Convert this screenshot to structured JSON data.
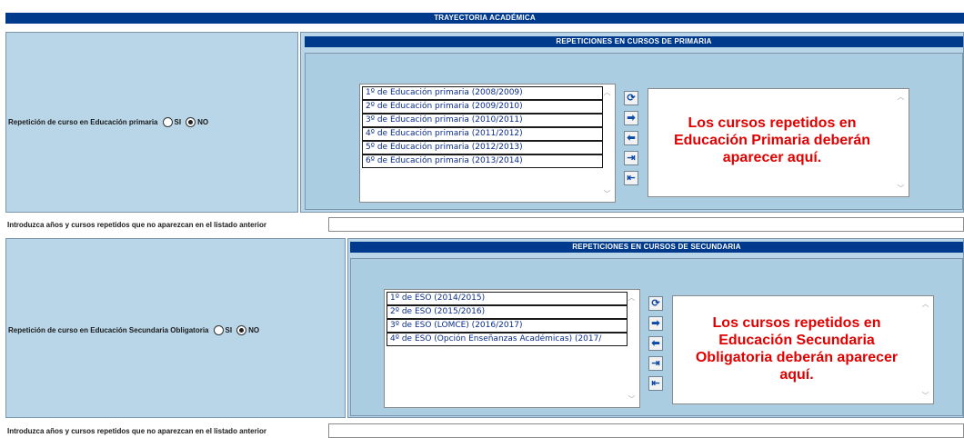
{
  "title": "TRAYECTORIA ACADÉMICA",
  "primaria": {
    "question": "Repetición de curso en Educación primaria",
    "radio_si": "SI",
    "radio_no": "NO",
    "selected": "NO",
    "header": "REPETICIONES EN CURSOS DE PRIMARIA",
    "courses": [
      "1º de Educación primaria (2008/2009)",
      "2º de Educación primaria (2009/2010)",
      "3º de Educación primaria (2010/2011)",
      "4º de Educación primaria (2011/2012)",
      "5º de Educación primaria (2012/2013)",
      "6º de Educación primaria (2013/2014)"
    ],
    "message": "Los cursos repetidos en Educación Primaria deberán aparecer aquí.",
    "other_label": "Introduzca años y cursos repetidos que no aparezcan en el listado anterior",
    "other_value": ""
  },
  "secundaria": {
    "question": "Repetición de curso en Educación Secundaria Obligatoria",
    "radio_si": "SI",
    "radio_no": "NO",
    "selected": "NO",
    "header": "REPETICIONES EN CURSOS DE SECUNDARIA",
    "courses": [
      "1º de ESO (2014/2015)",
      "2º de ESO (2015/2016)",
      "3º de ESO (LOMCE) (2016/2017)",
      "4º de ESO (Opción Enseñanzas Académicas) (2017/"
    ],
    "message": "Los cursos repetidos en Educación Secundaria Obligatoria deberán aparecer aquí.",
    "other_label": "Introduzca años y cursos repetidos que no aparezcan en el listado anterior",
    "other_value": ""
  },
  "buttons": {
    "refresh": "refresh-icon",
    "add": "arrow-right-icon",
    "remove": "arrow-left-icon",
    "add_all": "arrow-right-bar-icon",
    "remove_all": "arrow-left-bar-icon"
  },
  "colors": {
    "header": "#003a8c",
    "panel": "#b9d6e8",
    "message": "#e00000",
    "item_text": "#0a2d8a"
  }
}
